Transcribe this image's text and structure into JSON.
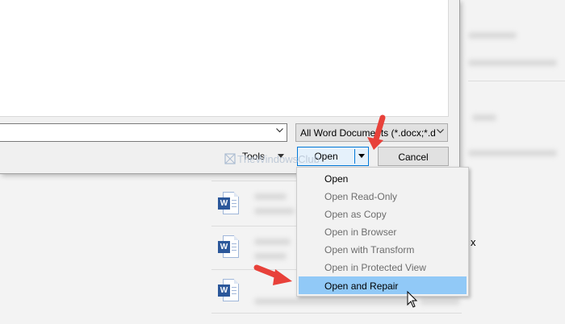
{
  "dialog": {
    "file_type_filter": "All Word Documents (*.docx;*.d",
    "tools_label": "Tools",
    "open_label": "Open",
    "cancel_label": "Cancel"
  },
  "open_menu": {
    "items": [
      {
        "label": "Open",
        "enabled": true,
        "highlighted": false
      },
      {
        "label": "Open Read-Only",
        "enabled": false,
        "highlighted": false
      },
      {
        "label": "Open as Copy",
        "enabled": false,
        "highlighted": false
      },
      {
        "label": "Open in Browser",
        "enabled": false,
        "highlighted": false
      },
      {
        "label": "Open with Transform",
        "enabled": false,
        "highlighted": false
      },
      {
        "label": "Open in Protected View",
        "enabled": false,
        "highlighted": false
      },
      {
        "label": "Open and Repair",
        "enabled": true,
        "highlighted": true
      }
    ]
  },
  "watermark": {
    "text": "TheWindowsClub"
  },
  "background": {
    "doc_badge": "W",
    "doc_extension_fragment": "x"
  },
  "colors": {
    "accent_blue": "#0078d7",
    "menu_highlight": "#91c9f7",
    "annotation_arrow": "#e8413a",
    "word_blue": "#2b579a"
  }
}
